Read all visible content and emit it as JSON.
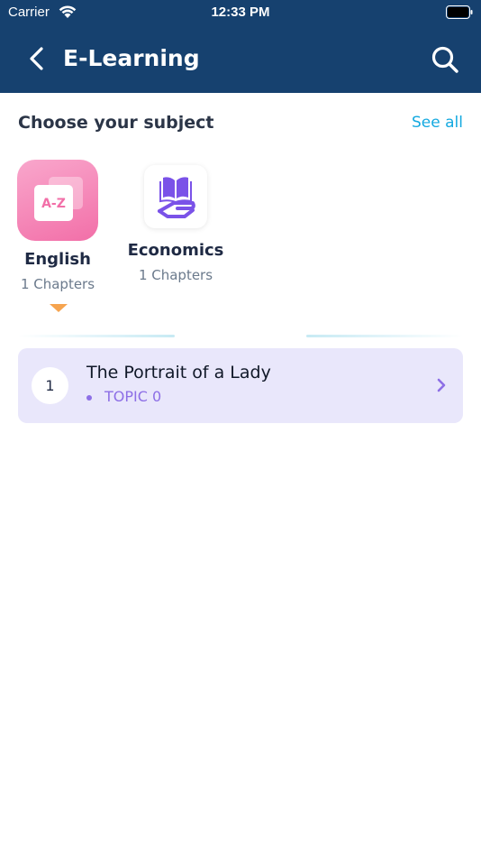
{
  "status_bar": {
    "carrier": "Carrier",
    "time": "12:33 PM"
  },
  "nav": {
    "title": "E-Learning",
    "icons": {
      "back": "chevron-left-icon",
      "search": "search-icon"
    }
  },
  "subjects_section": {
    "title": "Choose your subject",
    "see_all": "See all",
    "subjects": [
      {
        "name": "English",
        "chapters": "1 Chapters",
        "icon_text": "A-Z",
        "icon": "a-z-cards-icon",
        "active": true
      },
      {
        "name": "Economics",
        "chapters": "1 Chapters",
        "icon": "book-hand-icon",
        "active": false
      }
    ]
  },
  "chapters": [
    {
      "number": "1",
      "title": "The Portrait of  a Lady",
      "topic": "TOPIC 0"
    }
  ],
  "colors": {
    "header": "#16416f",
    "accent_link": "#14a9e0",
    "english_tile": "#f26fa8",
    "economics_icon": "#7a52e8",
    "active_caret": "#f6a44f",
    "card_bg": "#e9e7fb",
    "topic": "#8d6fe6"
  }
}
